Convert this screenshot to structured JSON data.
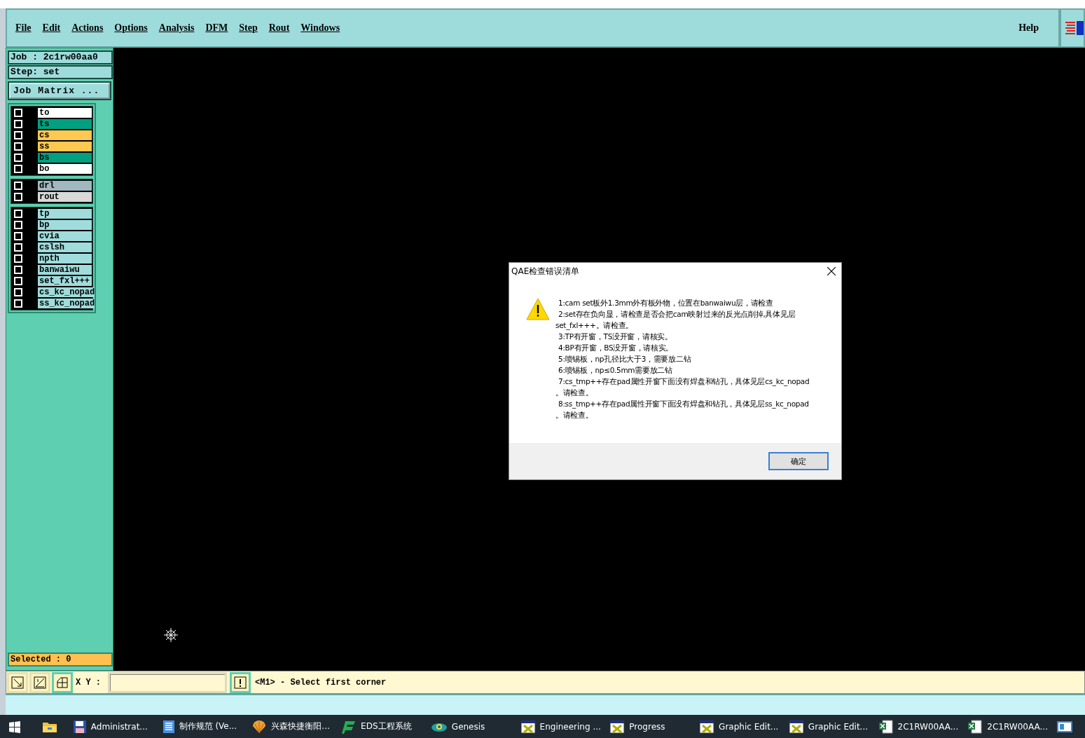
{
  "menu_bar": {
    "items": [
      {
        "label": "File"
      },
      {
        "label": "Edit"
      },
      {
        "label": "Actions"
      },
      {
        "label": "Options"
      },
      {
        "label": "Analysis"
      },
      {
        "label": "DFM"
      },
      {
        "label": "Step"
      },
      {
        "label": "Rout"
      },
      {
        "label": "Windows"
      }
    ],
    "help": "Help"
  },
  "side_panel": {
    "job": "Job : 2c1rw00aa0",
    "step": "Step: set",
    "job_matrix_button": "Job Matrix ...",
    "layer_groups": [
      {
        "layers": [
          {
            "name": "to",
            "color": "#ffffff",
            "checked": false
          },
          {
            "name": "ts",
            "color": "#00a080",
            "checked": false
          },
          {
            "name": "cs",
            "color": "#ffc850",
            "checked": false
          },
          {
            "name": "ss",
            "color": "#ffc850",
            "checked": false
          },
          {
            "name": "bs",
            "color": "#00a080",
            "checked": false
          },
          {
            "name": "bo",
            "color": "#ffffff",
            "checked": false
          }
        ]
      },
      {
        "layers": [
          {
            "name": "drl",
            "color": "#a0b8c0",
            "checked": false
          },
          {
            "name": "rout",
            "color": "#d8d8d8",
            "checked": false
          }
        ]
      },
      {
        "layers": [
          {
            "name": "tp",
            "color": "#a0dcdc",
            "checked": false
          },
          {
            "name": "bp",
            "color": "#a0dcdc",
            "checked": false
          },
          {
            "name": "cvia",
            "color": "#a0dcdc",
            "checked": false
          },
          {
            "name": "cslsh",
            "color": "#a0dcdc",
            "checked": false
          },
          {
            "name": "npth",
            "color": "#a0dcdc",
            "checked": false
          },
          {
            "name": "banwaiwu",
            "color": "#a0dcdc",
            "checked": false
          },
          {
            "name": "set_fxl+++",
            "color": "#a0dcdc",
            "checked": false
          },
          {
            "name": "cs_kc_nopad",
            "color": "#a0dcdc",
            "checked": false
          },
          {
            "name": "ss_kc_nopad",
            "color": "#a0dcdc",
            "checked": false
          }
        ]
      }
    ],
    "selected": "Selected : 0"
  },
  "dialog": {
    "title": "QAE检查错误清单",
    "messages": [
      {
        "lines": [
          "1:cam set板外1.3mm外有板外物，位置在banwaiwu层，请检查"
        ]
      },
      {
        "lines": [
          "2:set存在负向显，请检查是否会把cam映射过来的反光点削掉,具体见层",
          "set_fxl+++。请检查。"
        ]
      },
      {
        "lines": [
          "3:TP有开窗，TS没开窗，请核实。"
        ]
      },
      {
        "lines": [
          "4:BP有开窗，BS没开窗，请核实。"
        ]
      },
      {
        "lines": [
          "5:喷锡板，np孔径比大于3，需要放二钻"
        ]
      },
      {
        "lines": [
          "6:喷锡板，np≤0.5mm需要放二钻"
        ]
      },
      {
        "lines": [
          "7:cs_tmp++存在pad属性开窗下面没有焊盘和钻孔，具体见层cs_kc_nopad",
          "。请检查。"
        ]
      },
      {
        "lines": [
          "8:ss_tmp++存在pad属性开窗下面没有焊盘和钻孔，具体见层ss_kc_nopad",
          "。请检查。"
        ]
      }
    ],
    "ok_button": "确定"
  },
  "status_bar": {
    "xy_label": "X Y :",
    "prompt": "<M1> - Select first corner"
  },
  "taskbar": {
    "items": [
      {
        "kind": "start"
      },
      {
        "kind": "folder"
      },
      {
        "kind": "disk",
        "label": "Administrat..."
      },
      {
        "kind": "doc",
        "label": "制作规范 (Ve..."
      },
      {
        "kind": "shell",
        "label": "兴森快捷衡阳..."
      },
      {
        "kind": "eds",
        "label": "EDS工程系统"
      },
      {
        "kind": "genesis",
        "label": "Genesis"
      },
      {
        "kind": "xwin",
        "label": "Engineering ..."
      },
      {
        "kind": "xwin",
        "label": "Progress"
      },
      {
        "kind": "xwin",
        "label": "Graphic Edit..."
      },
      {
        "kind": "xwin",
        "label": "Graphic Edit..."
      },
      {
        "kind": "excel",
        "label": "2C1RW00AA..."
      },
      {
        "kind": "excel",
        "label": "2C1RW00AA..."
      },
      {
        "kind": "app"
      }
    ]
  }
}
